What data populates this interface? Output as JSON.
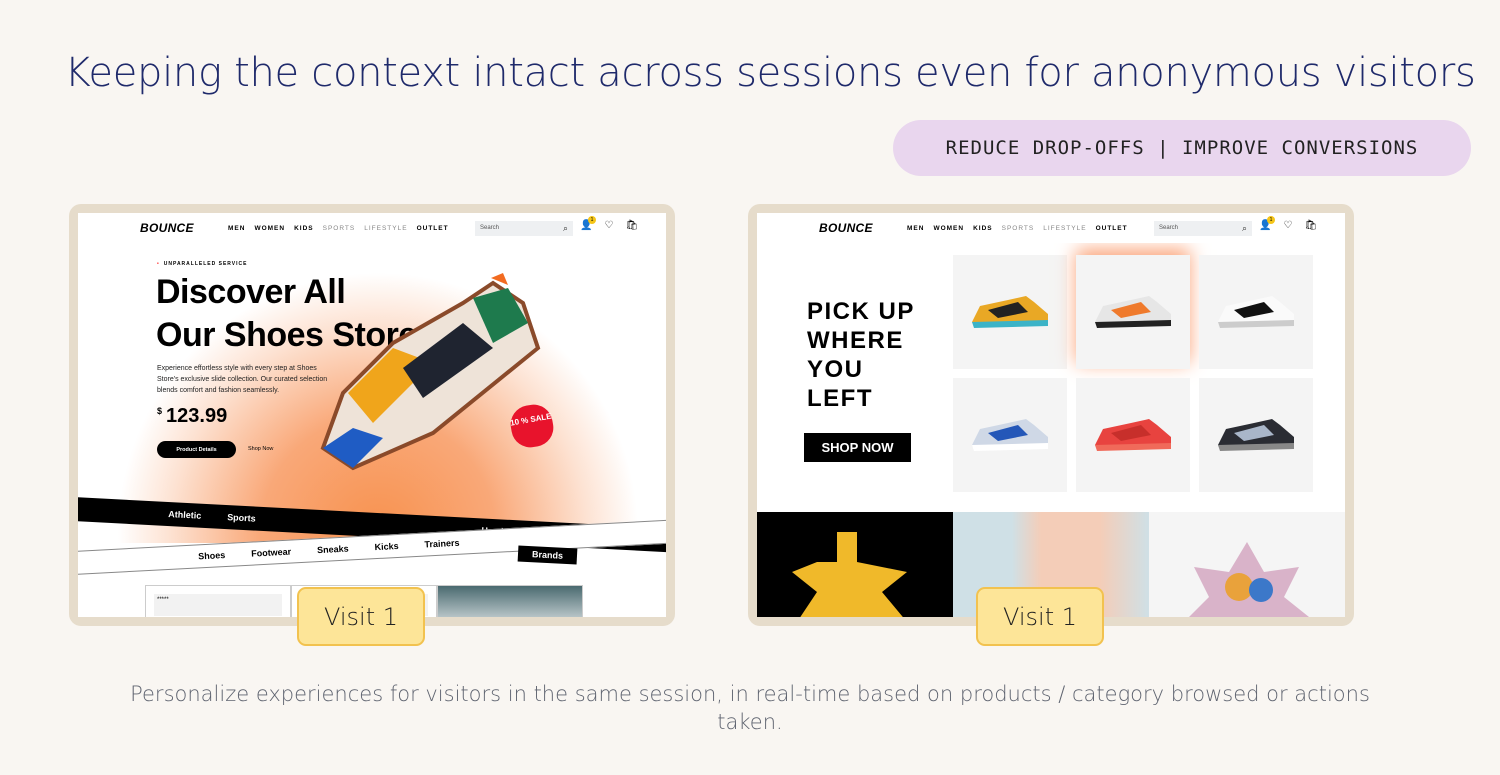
{
  "headline": "Keeping the context intact across sessions even for anonymous visitors",
  "tagline": "REDUCE DROP-OFFS | IMPROVE CONVERSIONS",
  "caption": "Personalize experiences for visitors in the same session, in real-time based on products / category browsed or actions taken.",
  "store": {
    "logo": "BOUNCE",
    "menu": [
      "MEN",
      "WOMEN",
      "KIDS",
      "SPORTS",
      "LIFESTYLE",
      "OUTLET"
    ],
    "search_placeholder": "Search",
    "cart_badge": "1"
  },
  "left_panel": {
    "eyebrow": "UNPARALLELED SERVICE",
    "heading_line1": "Discover All",
    "heading_line2": "Our Shoes Store !",
    "description": "Experience effortless style with every step at Shoes Store's exclusive slide collection. Our curated selection blends comfort and fashion seamlessly.",
    "currency": "$",
    "price": "123.99",
    "product_details": "Product Details",
    "shop_now": "Shop Now",
    "sale": "10 % SALE",
    "ribbon1": [
      "Athletic",
      "Sports",
      "Heads",
      "Brands"
    ],
    "ribbon2": [
      "Shoes",
      "Footwear",
      "Sneaks",
      "Kicks",
      "Trainers"
    ],
    "card_text": "*****",
    "visit_label": "Visit 1"
  },
  "right_panel": {
    "heading": [
      "PICK UP",
      "WHERE",
      "YOU",
      "LEFT"
    ],
    "shop_now": "SHOP NOW",
    "visit_label": "Visit 1",
    "products": [
      {
        "colors": [
          "#e9a825",
          "#222",
          "#3bb3c7"
        ]
      },
      {
        "colors": [
          "#e6e6e6",
          "#ef7a2c",
          "#222"
        ]
      },
      {
        "colors": [
          "#fafafa",
          "#111",
          "#ccc"
        ]
      },
      {
        "colors": [
          "#cfd8e6",
          "#2457b8",
          "#fff"
        ]
      },
      {
        "colors": [
          "#e8433f",
          "#c72f2b",
          "#f06a5a"
        ]
      },
      {
        "colors": [
          "#2a2c33",
          "#a9b6c9",
          "#888"
        ]
      }
    ]
  },
  "colors": {
    "title": "#1f2a6b",
    "pill": "#e9d6ee",
    "frame": "#e6dccb",
    "visit": "#fde598",
    "accent": "#f8924f"
  }
}
